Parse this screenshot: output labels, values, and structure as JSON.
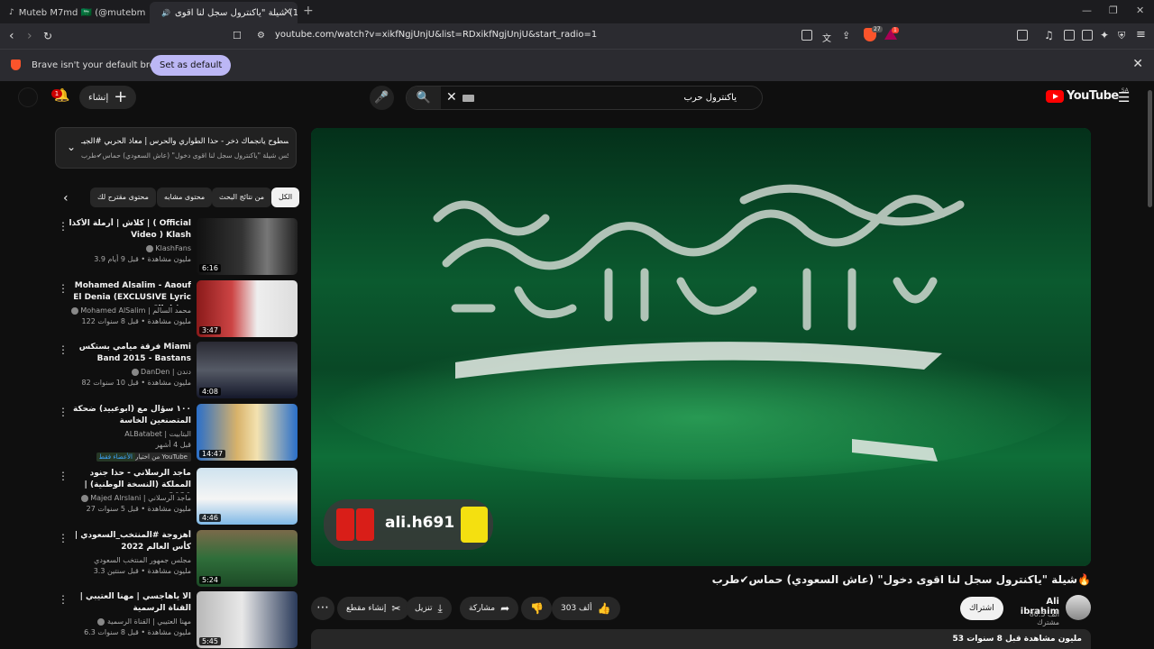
{
  "browser": {
    "tabs": [
      {
        "label": "Muteb M7md 🇸🇦 (@mutebm7md)"
      },
      {
        "label": "(1) شيلة \"ياكنترول سجل لنا اقوى"
      }
    ],
    "url": "youtube.com/watch?v=xikfNgjUnjU&list=RDxikfNgjUnjU&start_radio=1",
    "notification_text": "Brave isn't your default browser",
    "set_default_label": "Set as default",
    "shields_count": "27",
    "rewards_count": "1"
  },
  "header": {
    "create_label": "إنشاء",
    "notification_count": "1",
    "search_query": "ياكنترول حرب",
    "logo_text": "YouTube",
    "region": "SA"
  },
  "next_up": {
    "line1": "التالي: سطوح يانجماك ذخر - حذا الطواري والحرس | معاذ الحربي #الجيـ...",
    "line2": "ميكس شيلة \"ياكنترول سجل لنا اقوى دخول\" (عاش السعودي) حماس✔طرب🔥"
  },
  "chips": [
    {
      "label": "الكل"
    },
    {
      "label": "من نتائج البحث"
    },
    {
      "label": "محتوى مشابه"
    },
    {
      "label": "محتوى مقترح لك"
    }
  ],
  "recommendations": [
    {
      "title": "كلاش | أرملة الأكذا | ( Official Video ) Klash",
      "channel": "KlashFans",
      "meta": "3.9 مليون مشاهدة • قبل 9 أيام",
      "duration": "6:16"
    },
    {
      "title": "Mohamed Alsalim - Aaouf El Denia (EXCLUSIVE Lyric Clip) | ...",
      "channel": "Mohamed AlSalim | محمد السالم",
      "meta": "122 مليون مشاهدة • قبل 8 سنوات",
      "duration": "3:47"
    },
    {
      "title": "فرقة ميامي بستكس Miami Band 2015 - Bastans",
      "channel": "DanDen | دندن",
      "meta": "82 مليون مشاهدة • قبل 10 سنوات",
      "duration": "4:08"
    },
    {
      "title": "١٠٠ سؤال مع (ابوعبيد) ضحكة المتصنعين الخاسة",
      "channel": "ALBatabet | البتابيت",
      "meta": "قبل 4 أشهر",
      "duration": "14:47",
      "badge": "من اختيار YouTube",
      "badge2": "الأعضاء فقط"
    },
    {
      "title": "ماجد الرسلاني - حذا جنود المملكة (النسخة الوطنية) | 2020",
      "channel": "Majed Alrslani | ماجد الرسلاني",
      "meta": "27 مليون مشاهدة • قبل 5 سنوات",
      "duration": "4:46"
    },
    {
      "title": "أهزوجة #المنتخب_السعودي | كأس العالم 2022",
      "channel": "مجلس جمهور المنتخب السعودي",
      "meta": "3.3 مليون مشاهدة • قبل سنتين",
      "duration": "5:24"
    },
    {
      "title": "الا ياهاجسي | مهنا العتيبي | القناة الرسمية",
      "channel": "مهنا العتيبي | القناة الرسمية",
      "meta": "6.3 مليون مشاهدة • قبل 8 سنوات",
      "duration": "5:45"
    }
  ],
  "video": {
    "title": "شيلة \"ياكنترول سجل لنا اقوى دخول\" (عاش السعودي) حماس✔طرب🔥",
    "watermark": "ali.h691",
    "channel_name": "Ali ibrahim",
    "channel_subs": "80.5 ألف مشترك",
    "subscribe_label": "اشتراك",
    "like_count": "303 ألف",
    "share_label": "مشاركة",
    "download_label": "تنزيل",
    "clip_label": "إنشاء مقطع",
    "views_line": "53 مليون مشاهدة قبل 8 سنوات"
  },
  "colors": {
    "background": "#0f0f0f",
    "brand_red": "#ff0000",
    "flag_green": "#0a6b34",
    "brave_orange": "#fb542b",
    "set_default_bg": "#bcb7f5"
  }
}
